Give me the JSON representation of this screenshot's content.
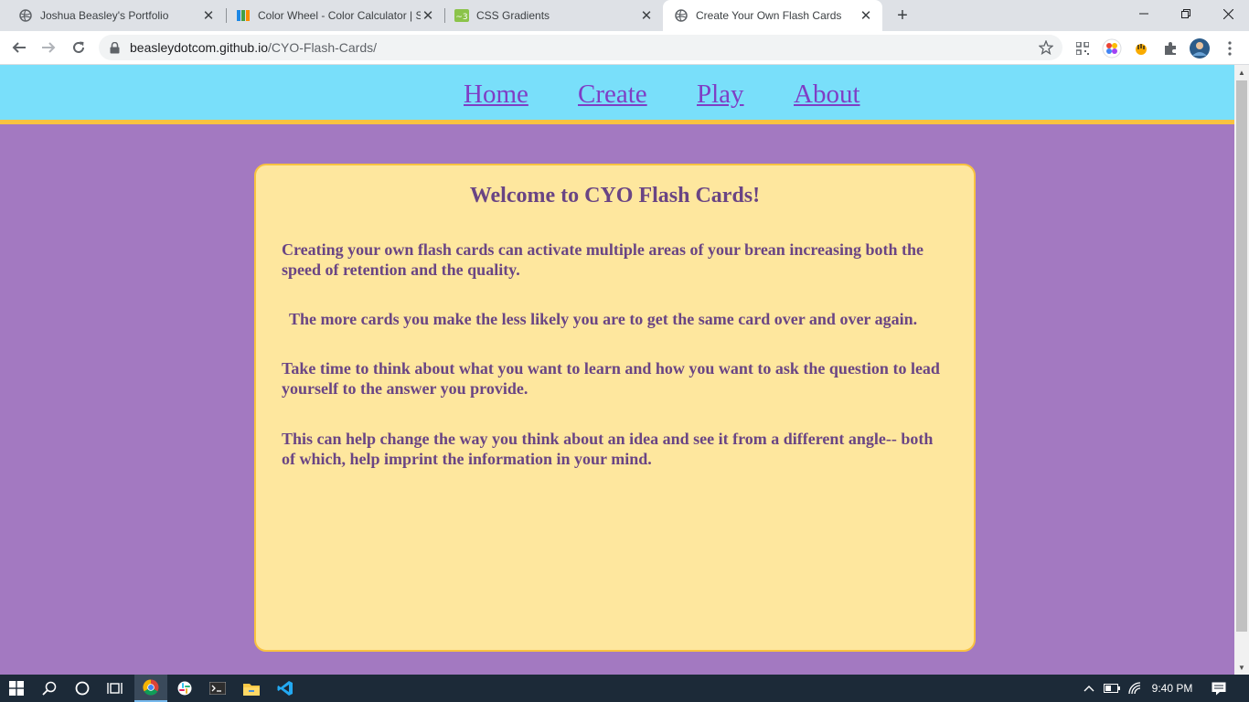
{
  "browser": {
    "tabs": [
      {
        "title": "Joshua Beasley's Portfolio",
        "icon": "globe-icon",
        "active": false
      },
      {
        "title": "Color Wheel - Color Calculator | S",
        "icon": "color-wheel-favicon",
        "active": false
      },
      {
        "title": "CSS Gradients",
        "icon": "css-gradient-favicon",
        "active": false
      },
      {
        "title": "Create Your Own Flash Cards",
        "icon": "globe-icon",
        "active": true
      }
    ],
    "address": {
      "domain": "beasleydotcom.github.io",
      "path": "/CYO-Flash-Cards/"
    }
  },
  "site": {
    "nav": [
      {
        "label": "Home"
      },
      {
        "label": "Create"
      },
      {
        "label": "Play"
      },
      {
        "label": "About"
      }
    ],
    "card": {
      "title": "Welcome to CYO Flash Cards!",
      "paragraphs": [
        "Creating your own flash cards can activate multiple areas of your brean increasing both the speed of retention and the quality.",
        "The more cards you make the less likely you are to get the same card over and over again.",
        "Take time to think about what you want to learn and how you want to ask the question to lead yourself to the answer you provide.",
        "This can help change the way you think about an idea and see it from a different angle-- both of which, help imprint the information in your mind."
      ]
    }
  },
  "taskbar": {
    "clock": "9:40 PM"
  },
  "colors": {
    "page_background": "#a379c1",
    "nav_background": "#79dffa",
    "accent_border": "#f8c240",
    "card_background": "#fee79e",
    "card_text": "#6a4584",
    "link": "#7f3ec5"
  }
}
